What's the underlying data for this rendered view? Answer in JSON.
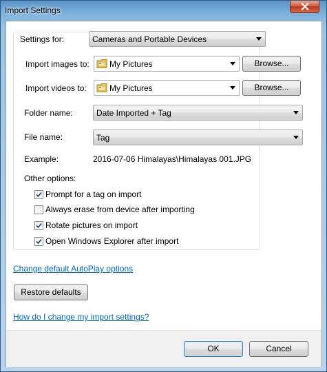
{
  "window": {
    "title": "Import Settings"
  },
  "settings_for": {
    "label": "Settings for:",
    "value": "Cameras and Portable Devices"
  },
  "import_images": {
    "label": "Import images to:",
    "value": "My Pictures",
    "browse_label": "Browse..."
  },
  "import_videos": {
    "label": "Import videos to:",
    "value": "My Pictures",
    "browse_label": "Browse..."
  },
  "folder_name": {
    "label": "Folder name:",
    "value": "Date Imported + Tag"
  },
  "file_name": {
    "label": "File name:",
    "value": "Tag"
  },
  "example": {
    "label": "Example:",
    "value": "2016-07-06 Himalayas\\Himalayas 001.JPG"
  },
  "other_options": {
    "label": "Other options:",
    "items": [
      {
        "label": "Prompt for a tag on import",
        "checked": true
      },
      {
        "label": "Always erase from device after importing",
        "checked": false
      },
      {
        "label": "Rotate pictures on import",
        "checked": true
      },
      {
        "label": "Open Windows Explorer after import",
        "checked": true
      }
    ]
  },
  "links": {
    "autoplay": "Change default AutoPlay options",
    "help": "How do I change my import settings?"
  },
  "restore_label": "Restore defaults",
  "footer": {
    "ok_label": "OK",
    "cancel_label": "Cancel"
  },
  "colors": {
    "link": "#0066cc",
    "close_button": "#c0391c",
    "title_bar": "#7eb3dd"
  },
  "icons": {
    "close": "close-icon",
    "folder": "folder-icon",
    "dropdown": "chevron-down-icon",
    "check": "checkmark-icon"
  }
}
